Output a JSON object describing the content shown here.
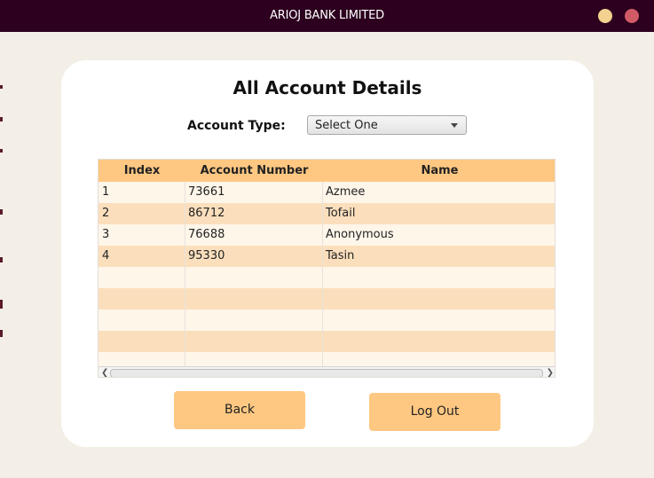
{
  "window": {
    "title": "ARIOJ BANK LIMITED"
  },
  "page": {
    "heading": "All Account Details"
  },
  "filter": {
    "label": "Account Type:",
    "selected": "Select One"
  },
  "table": {
    "columns": [
      "Index",
      "Account Number",
      "Name"
    ],
    "rows": [
      [
        "1",
        "73661",
        "Azmee"
      ],
      [
        "2",
        "86712",
        "Tofail"
      ],
      [
        "3",
        "76688",
        "Anonymous"
      ],
      [
        "4",
        "95330",
        "Tasin"
      ]
    ],
    "empty_rows": 5
  },
  "buttons": {
    "back": "Back",
    "logout": "Log Out"
  },
  "colors": {
    "accent": "#ffc882",
    "row_alt": "#fbdfbd",
    "row_base": "#fff6ea",
    "titlebar": "#2c001e"
  }
}
